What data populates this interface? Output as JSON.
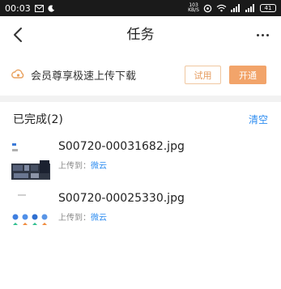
{
  "status_bar": {
    "time": "00:03",
    "net_speed_top": "103",
    "net_speed_bottom": "KB/S",
    "battery": "41"
  },
  "nav": {
    "title": "任务",
    "back_icon": "chevron-left-icon",
    "more_icon": "more-dots-icon"
  },
  "promo": {
    "icon": "vip-cloud-icon",
    "text": "会员尊享极速上传下载",
    "trial_label": "试用",
    "open_label": "开通",
    "accent_color": "#f2a46a"
  },
  "completed": {
    "title": "已完成(2)",
    "clear_label": "清空",
    "items": [
      {
        "name": "S00720-00031682.jpg",
        "dest_prefix": "上传到：",
        "dest": "微云"
      },
      {
        "name": "S00720-00025330.jpg",
        "dest_prefix": "上传到：",
        "dest": "微云"
      }
    ]
  },
  "colors": {
    "link": "#2d8cf0",
    "status_bar_bg": "#1a1a1a"
  }
}
